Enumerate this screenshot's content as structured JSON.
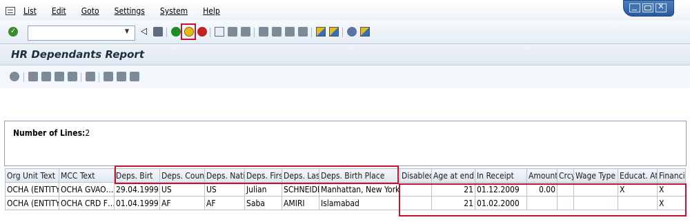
{
  "menubar": {
    "items": [
      {
        "label": "List"
      },
      {
        "label": "Edit"
      },
      {
        "label": "Goto"
      },
      {
        "label": "Settings"
      },
      {
        "label": "System"
      },
      {
        "label": "Help"
      }
    ]
  },
  "toolbar": {
    "command_field_value": "",
    "icons": [
      "enter-icon",
      "back-icon",
      "save-icon",
      "back-green-icon",
      "exit-icon",
      "cancel-icon",
      "print-icon",
      "find-icon",
      "find-next-icon",
      "first-page-icon",
      "previous-page-icon",
      "next-page-icon",
      "last-page-icon",
      "create-session-icon",
      "shortcut-icon",
      "help-icon",
      "customize-layout-icon"
    ]
  },
  "page": {
    "title": "HR Dependants Report"
  },
  "report": {
    "number_of_lines_label": "Number of Lines:",
    "number_of_lines_value": "2"
  },
  "grid": {
    "columns": [
      "Org Unit Text",
      "MCC Text",
      "Deps. Birt",
      "Deps. Coun",
      "Deps. Nati",
      "Deps. Firs",
      "Deps. Last",
      "Deps. Birth Place",
      "Disabled",
      "Age at end",
      "In Receipt",
      "Amount",
      "Crcy",
      "Wage Type",
      "Educat. At",
      "Financial"
    ],
    "rows": [
      [
        "OCHA (ENTITY)",
        "OCHA GVAO…",
        "29.04.1999",
        "US",
        "US",
        "Julian",
        "SCHNEIDER",
        "Manhattan, New York",
        "",
        "21",
        "01.12.2009",
        "0.00",
        "",
        "",
        "X",
        "X"
      ],
      [
        "OCHA (ENTITY)",
        "OCHA CRD F…",
        "01.04.1999",
        "AF",
        "AF",
        "Saba",
        "AMIRI",
        "Islamabad",
        "",
        "21",
        "01.02.2000",
        "",
        "",
        "",
        "",
        "X"
      ]
    ]
  },
  "colors": {
    "highlight_box": "#c8102e",
    "window_controls": "#2f64ac"
  }
}
